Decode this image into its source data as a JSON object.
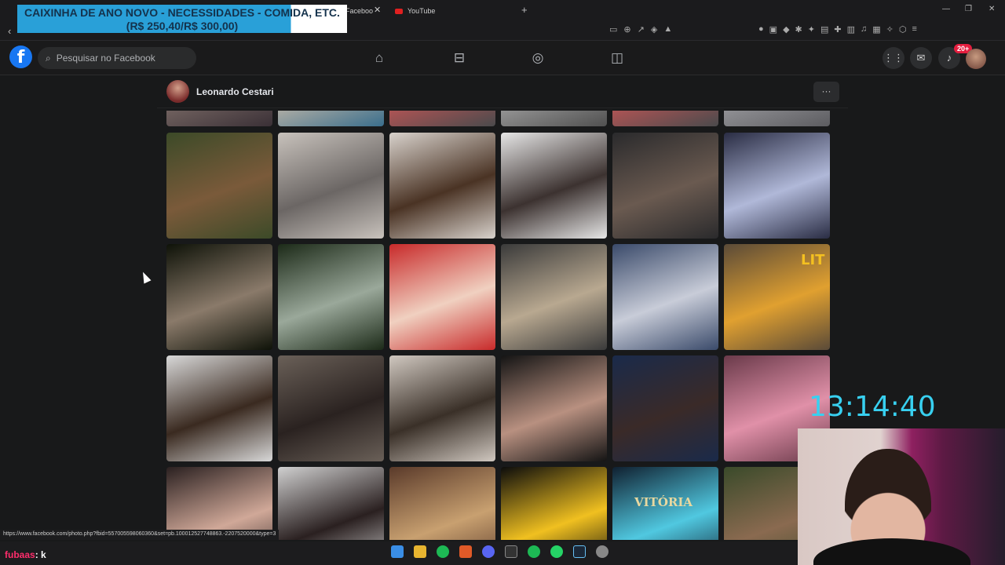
{
  "browser": {
    "tabs": [
      {
        "label": "Faceboo"
      },
      {
        "label": "YouTube"
      }
    ],
    "new_tab_glyph": "+",
    "close_glyph": "✕",
    "window_controls": [
      "—",
      "❐",
      "✕"
    ],
    "back_glyph": "‹"
  },
  "overlay": {
    "donation_line1": "CAIXINHA DE ANO NOVO - NECESSIDADES - COMIDA, ETC.",
    "donation_line2": "(R$ 250,40/R$ 300,00)",
    "timer": "13:14:40",
    "chat_user": "fubaas",
    "chat_message": ": k"
  },
  "facebook": {
    "search_placeholder": "Pesquisar no Facebook",
    "logo_letter": "f",
    "notification_count": "20+",
    "nav_icons": [
      "home-icon",
      "marketplace-icon",
      "groups-icon",
      "gaming-icon"
    ],
    "right_icons": [
      "menu-grid-icon",
      "messenger-icon",
      "bell-icon"
    ]
  },
  "profile": {
    "name": "Leonardo Cestari",
    "more_glyph": "···"
  },
  "status_bar": {
    "url": "https://www.facebook.com/photo.php?fbid=557005598060360&set=pb.100012527748863.-2207520000&type=3"
  },
  "photos": {
    "row0": [
      {
        "name": "photo-partial-1",
        "colors": [
          "#3a3036",
          "#7a6a66"
        ]
      },
      {
        "name": "photo-partial-2",
        "colors": [
          "#3a6e8c",
          "#c0b6a8"
        ]
      },
      {
        "name": "photo-partial-3",
        "colors": [
          "#4a4a4c",
          "#c05656"
        ]
      },
      {
        "name": "photo-partial-4",
        "colors": [
          "#505050",
          "#a0a0a0"
        ]
      },
      {
        "name": "photo-partial-5",
        "colors": [
          "#4a4a4c",
          "#c05656"
        ]
      },
      {
        "name": "photo-partial-6",
        "colors": [
          "#5c5c60",
          "#9a9a9e"
        ]
      }
    ],
    "row1": [
      {
        "name": "photo-child-fountain",
        "colors": [
          "#3c4a28",
          "#7a5a3a"
        ]
      },
      {
        "name": "photo-restaurant-table",
        "colors": [
          "#c8c2bc",
          "#6b6664"
        ]
      },
      {
        "name": "photo-three-kids",
        "colors": [
          "#d8d2cc",
          "#4a3324"
        ]
      },
      {
        "name": "photo-men-lying",
        "colors": [
          "#e6e6e6",
          "#3c3230"
        ]
      },
      {
        "name": "photo-three-men-suits",
        "colors": [
          "#2a2a2c",
          "#6a5a50"
        ]
      },
      {
        "name": "photo-tv-screen",
        "colors": [
          "#2a2d44",
          "#b0b8d8"
        ]
      }
    ],
    "row2": [
      {
        "name": "photo-night-friends",
        "colors": [
          "#0e1208",
          "#8a7a6a"
        ]
      },
      {
        "name": "photo-wine-glass",
        "colors": [
          "#1c2a18",
          "#9aa89a"
        ]
      },
      {
        "name": "photo-lightning-car",
        "colors": [
          "#c82a2a",
          "#f0d0c0"
        ]
      },
      {
        "name": "photo-video-screenshot",
        "colors": [
          "#3a3a3a",
          "#b8a890"
        ]
      },
      {
        "name": "photo-moon-castle",
        "colors": [
          "#3a4a6a",
          "#c8ccd8"
        ]
      },
      {
        "name": "photo-lit-selfie",
        "colors": [
          "#5a4a38",
          "#e0a030"
        ]
      }
    ],
    "row3": [
      {
        "name": "photo-beer-selfie",
        "colors": [
          "#d8d8d8",
          "#3a2a20"
        ]
      },
      {
        "name": "photo-two-guys-selfie",
        "colors": [
          "#6a6058",
          "#2a2220"
        ]
      },
      {
        "name": "photo-two-friends-smile",
        "colors": [
          "#d0c8c0",
          "#3a3028"
        ]
      },
      {
        "name": "photo-tv-game",
        "colors": [
          "#141414",
          "#b89080"
        ]
      },
      {
        "name": "photo-couple-selfie",
        "colors": [
          "#1a2a4a",
          "#3a2a28"
        ]
      },
      {
        "name": "photo-hearts-couple",
        "colors": [
          "#6a3a4a",
          "#e090a8"
        ]
      }
    ],
    "row4": [
      {
        "name": "photo-woman-portrait",
        "colors": [
          "#2a2020",
          "#d0a898"
        ]
      },
      {
        "name": "photo-man-close",
        "colors": [
          "#d0d0d0",
          "#2a2020"
        ]
      },
      {
        "name": "photo-two-faces",
        "colors": [
          "#5a3a2a",
          "#c8a070"
        ]
      },
      {
        "name": "photo-sunflower",
        "colors": [
          "#0c0c0c",
          "#f0c020"
        ]
      },
      {
        "name": "photo-vitoria-badge",
        "colors": [
          "#102030",
          "#50c8e0"
        ]
      },
      {
        "name": "photo-man-back",
        "colors": [
          "#3a4a2a",
          "#8a6a50"
        ]
      }
    ]
  },
  "photo_text": {
    "lit": "LIT",
    "vitoria": "VITÓRIA"
  }
}
